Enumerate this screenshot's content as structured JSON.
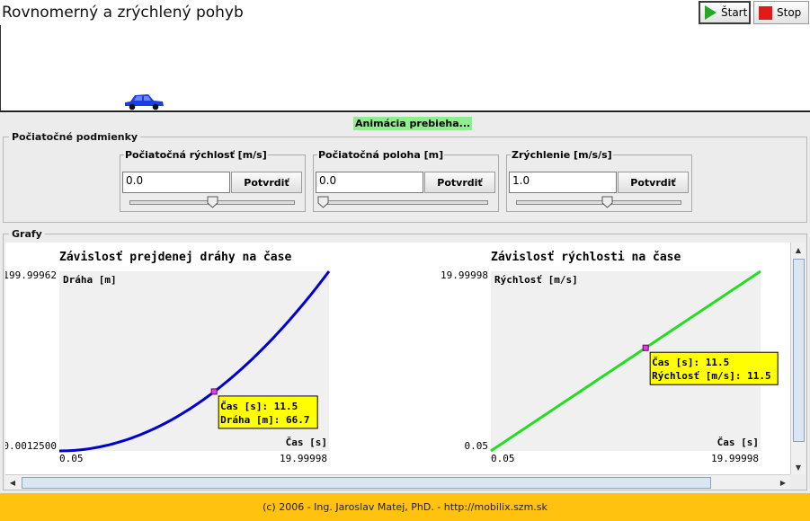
{
  "app_title": "Rovnomerný a zrýchlený pohyb",
  "toolbar": {
    "start_label": "Štart",
    "stop_label": "Stop"
  },
  "status": "Animácia prebieha...",
  "car_progress": 0.158,
  "initial_conditions": {
    "title": "Počiatočné podmienky",
    "params": [
      {
        "label": "Počiatočná rýchlosť [m/s]",
        "value": "0.0",
        "button": "Potvrdiť",
        "slider_fraction": 0.5
      },
      {
        "label": "Počiatočná poloha [m]",
        "value": "0.0",
        "button": "Potvrdiť",
        "slider_fraction": 0.0
      },
      {
        "label": "Zrýchlenie [m/s/s]",
        "value": "1.0",
        "button": "Potvrdiť",
        "slider_fraction": 0.55
      }
    ]
  },
  "graphs": {
    "title": "Grafy"
  },
  "chart_data": [
    {
      "type": "line",
      "title": "Závislosť prejdenej dráhy na čase",
      "ylabel": "Dráha [m]",
      "xlabel": "Čas [s]",
      "x_min_label": "0.05",
      "x_max_label": "19.99998",
      "y_min_label": "0.0012500",
      "y_max_label": "199.99962",
      "xlim": [
        0.05,
        19.99998
      ],
      "ylim": [
        0.00125,
        199.99962
      ],
      "series": [
        {
          "x": [
            0.05,
            2,
            4,
            6,
            8,
            10,
            11.5,
            12,
            14,
            16,
            18,
            19.99998
          ],
          "y": [
            0.00125,
            2,
            8,
            18,
            32,
            50,
            66.1,
            72,
            98,
            128,
            162,
            199.99962
          ],
          "color": "#0000cc"
        }
      ],
      "marker": {
        "x": 11.5,
        "y": 66.1
      },
      "tooltip": {
        "line1": "Čas [s]: 11.5",
        "line2": "Dráha [m]: 66.7"
      },
      "plot_bg": "#f0f0f0"
    },
    {
      "type": "line",
      "title": "Závislosť rýchlosti na čase",
      "ylabel": "Rýchlosť [m/s]",
      "xlabel": "Čas [s]",
      "x_min_label": "0.05",
      "x_max_label": "19.99998",
      "y_min_label": "0.05",
      "y_max_label": "19.99998",
      "xlim": [
        0.05,
        19.99998
      ],
      "ylim": [
        0.05,
        19.99998
      ],
      "series": [
        {
          "x": [
            0.05,
            19.99998
          ],
          "y": [
            0.05,
            19.99998
          ],
          "color": "#22dd22"
        }
      ],
      "marker": {
        "x": 11.5,
        "y": 11.5
      },
      "tooltip": {
        "line1": "Čas [s]: 11.5",
        "line2": "Rýchlosť [m/s]: 11.5"
      },
      "plot_bg": "#f0f0f0"
    }
  ],
  "footer": "(c) 2006 - Ing. Jaroslav Matej, PhD. - http://mobilix.szm.sk"
}
